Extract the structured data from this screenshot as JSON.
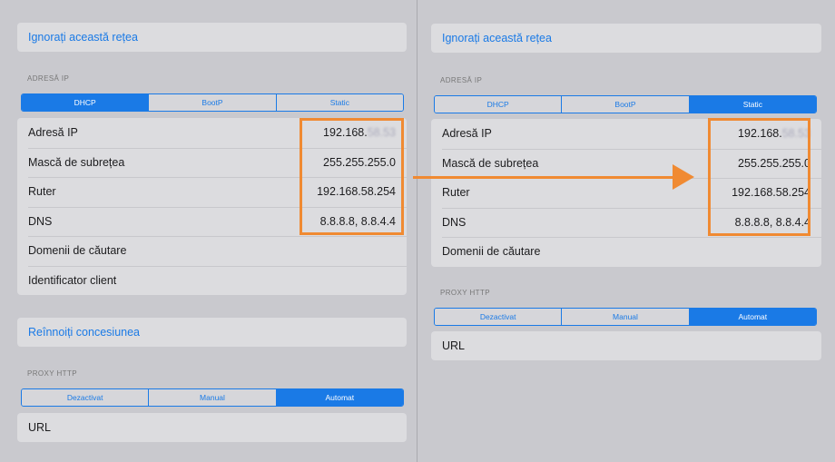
{
  "left": {
    "forget_network": "Ignorați această rețea",
    "ip_section_label": "ADRESĂ IP",
    "ip_modes": [
      "DHCP",
      "BootP",
      "Static"
    ],
    "rows": [
      {
        "label": "Adresă IP",
        "value_prefix": "192.168.",
        "value_blurred": "58.53"
      },
      {
        "label": "Mască de subrețea",
        "value": "255.255.255.0"
      },
      {
        "label": "Ruter",
        "value": "192.168.58.254"
      },
      {
        "label": "DNS",
        "value": "8.8.8.8, 8.8.4.4"
      },
      {
        "label": "Domenii de căutare",
        "value": ""
      },
      {
        "label": "Identificator client",
        "value": ""
      }
    ],
    "renew_lease": "Reînnoiți concesiunea",
    "proxy_section_label": "PROXY HTTP",
    "proxy_modes": [
      "Dezactivat",
      "Manual",
      "Automat"
    ],
    "url_label": "URL"
  },
  "right": {
    "forget_network": "Ignorați această rețea",
    "ip_section_label": "ADRESĂ IP",
    "ip_modes": [
      "DHCP",
      "BootP",
      "Static"
    ],
    "rows": [
      {
        "label": "Adresă IP",
        "value_prefix": "192.168.",
        "value_blurred": "58.53"
      },
      {
        "label": "Mască de subrețea",
        "value": "255.255.255.0"
      },
      {
        "label": "Ruter",
        "value": "192.168.58.254"
      },
      {
        "label": "DNS",
        "value": "8.8.8.8, 8.8.4.4"
      },
      {
        "label": "Domenii de căutare",
        "value": ""
      }
    ],
    "proxy_section_label": "PROXY HTTP",
    "proxy_modes": [
      "Dezactivat",
      "Manual",
      "Automat"
    ],
    "url_label": "URL"
  },
  "colors": {
    "accent": "#1a7ae6",
    "highlight": "#f08a32",
    "background": "#c9c9ce",
    "card": "#dcdcdf"
  },
  "state": {
    "left_ip_mode_selected": "DHCP",
    "left_proxy_mode_selected": "Automat",
    "right_ip_mode_selected": "Static",
    "right_proxy_mode_selected": "Automat"
  }
}
